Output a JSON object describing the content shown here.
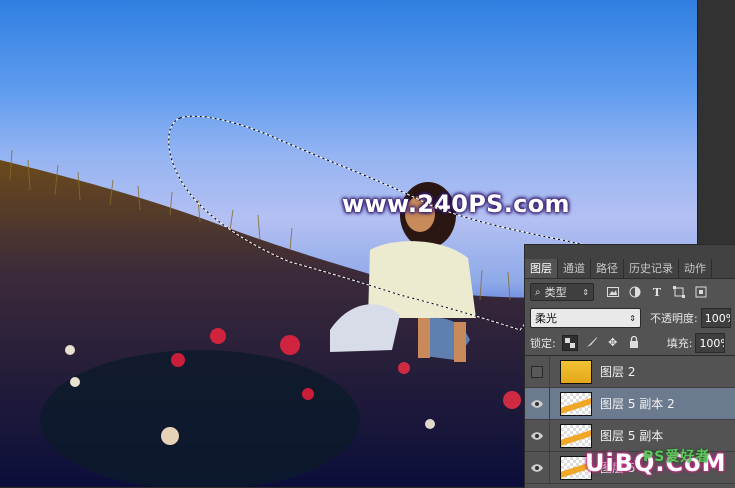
{
  "canvas": {
    "watermark": "www.240PS.com"
  },
  "layers_panel": {
    "tabs": [
      {
        "label": "图层",
        "active": true
      },
      {
        "label": "通道",
        "active": false
      },
      {
        "label": "路径",
        "active": false
      },
      {
        "label": "历史记录",
        "active": false
      },
      {
        "label": "动作",
        "active": false
      }
    ],
    "filter": {
      "label": "类型",
      "search_icon": "search-icon",
      "dropdown_icon": "updown-arrow-icon"
    },
    "filter_icons": [
      "image-filter-icon",
      "adjustment-filter-icon",
      "text-filter-icon",
      "shape-filter-icon",
      "smartobject-filter-icon"
    ],
    "blend_mode": "柔光",
    "opacity_label": "不透明度:",
    "opacity_value": "100%",
    "lock_label": "锁定:",
    "lock_icons": [
      "lock-transparent-icon",
      "lock-paint-icon",
      "lock-position-icon",
      "lock-all-icon"
    ],
    "fill_label": "填充:",
    "fill_value": "100%",
    "layers": [
      {
        "name": "图层 2",
        "visible": false,
        "selected": false,
        "thumb": "solid-yellow"
      },
      {
        "name": "图层 5 副本 2",
        "visible": true,
        "selected": true,
        "thumb": "transparent-stripe"
      },
      {
        "name": "图层 5 副本",
        "visible": true,
        "selected": false,
        "thumb": "transparent-stripe"
      },
      {
        "name": "图层 5",
        "visible": true,
        "selected": false,
        "thumb": "transparent-stripe"
      }
    ]
  },
  "corner_watermark": {
    "text": "UiBQ.CoM",
    "cn_text": "PS爱好者"
  },
  "colors": {
    "sky_top": "#2f7fe0",
    "panel_bg": "#535353",
    "selected_layer": "#6b7a8f",
    "layer_thumb_stripe": "#f0a626"
  }
}
